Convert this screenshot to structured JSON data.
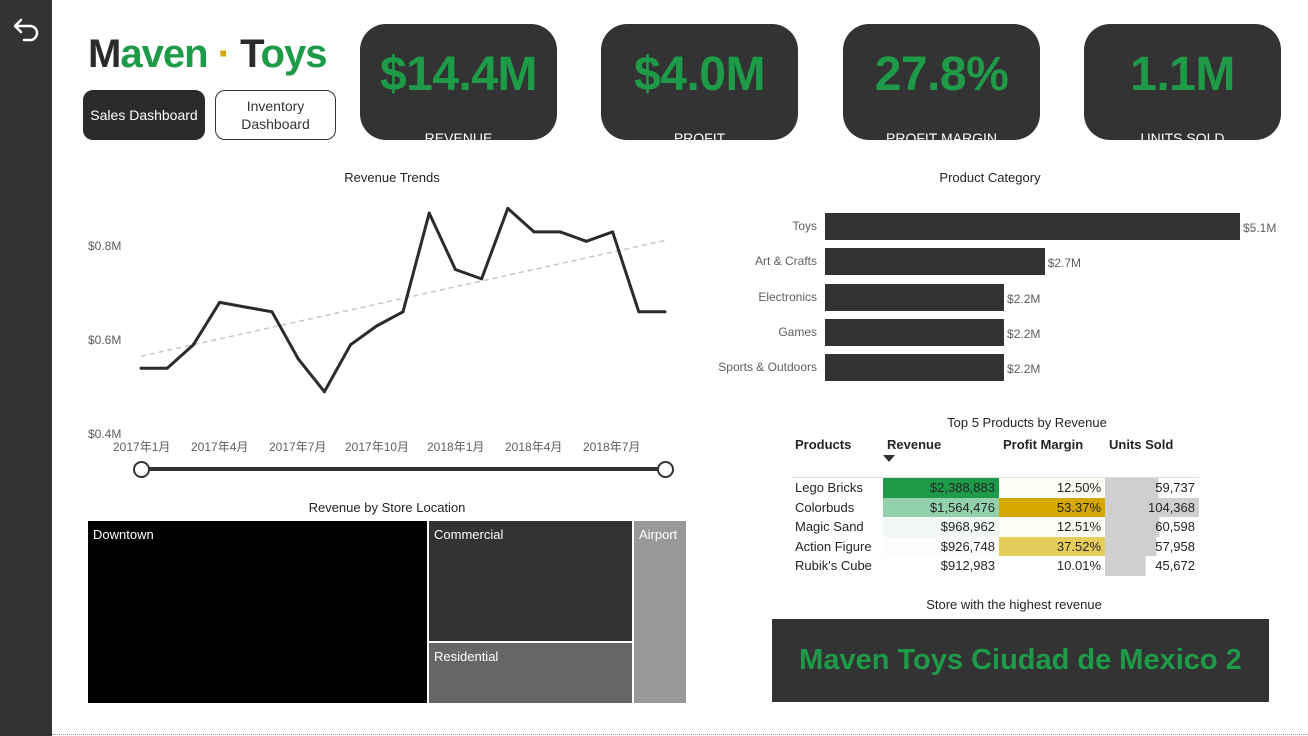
{
  "logo": {
    "part1_dark": "M",
    "part1_green": "aven",
    "dot": "·",
    "part2_dark": "T",
    "part2_green": "oys"
  },
  "nav": {
    "sales": "Sales Dashboard",
    "inventory": "Inventory Dashboard"
  },
  "kpis": [
    {
      "value": "$14.4M",
      "label": "REVENUE"
    },
    {
      "value": "$4.0M",
      "label": "PROFIT"
    },
    {
      "value": "27.8%",
      "label": "PROFIT MARGIN"
    },
    {
      "value": "1.1M",
      "label": "UNITS SOLD"
    }
  ],
  "revenue_trends": {
    "title": "Revenue Trends",
    "y_ticks": [
      "$0.8M",
      "$0.6M",
      "$0.4M"
    ],
    "x_ticks": [
      "2017年1月",
      "2017年4月",
      "2017年7月",
      "2017年10月",
      "2018年1月",
      "2018年4月",
      "2018年7月"
    ]
  },
  "product_category": {
    "title": "Product Category"
  },
  "top_products": {
    "title": "Top 5 Products by Revenue",
    "headers": [
      "Products",
      "Revenue",
      "Profit Margin",
      "Units Sold"
    ],
    "rows": [
      {
        "product": "Lego Bricks",
        "revenue": "$2,388,883",
        "margin": "12.50%",
        "units": "59,737"
      },
      {
        "product": "Colorbuds",
        "revenue": "$1,564,476",
        "margin": "53.37%",
        "units": "104,368"
      },
      {
        "product": "Magic Sand",
        "revenue": "$968,962",
        "margin": "12.51%",
        "units": "60,598"
      },
      {
        "product": "Action Figure",
        "revenue": "$926,748",
        "margin": "37.52%",
        "units": "57,958"
      },
      {
        "product": "Rubik's Cube",
        "revenue": "$912,983",
        "margin": "10.01%",
        "units": "45,672"
      }
    ]
  },
  "store_location": {
    "title": "Revenue by Store Location",
    "tiles": [
      "Downtown",
      "Commercial",
      "Residential",
      "Airport"
    ]
  },
  "highest_store": {
    "title": "Store with the highest revenue",
    "value": "Maven Toys Ciudad de Mexico 2"
  },
  "chart_data": [
    {
      "type": "line",
      "x": [
        "2017-01",
        "2017-02",
        "2017-03",
        "2017-04",
        "2017-05",
        "2017-06",
        "2017-07",
        "2017-08",
        "2017-09",
        "2017-10",
        "2017-11",
        "2017-12",
        "2018-01",
        "2018-02",
        "2018-03",
        "2018-04",
        "2018-05",
        "2018-06",
        "2018-07",
        "2018-08",
        "2018-09",
        "2018-10"
      ],
      "y": [
        0.54,
        0.54,
        0.59,
        0.68,
        0.67,
        0.66,
        0.56,
        0.49,
        0.59,
        0.63,
        0.66,
        0.87,
        0.75,
        0.73,
        0.88,
        0.83,
        0.83,
        0.81,
        0.83,
        0.66,
        0.66
      ],
      "trendline": true,
      "ylim": [
        0.4,
        0.9
      ],
      "xlabel": "",
      "ylabel": ""
    },
    {
      "type": "bar",
      "categories": [
        "Toys",
        "Art & Crafts",
        "Electronics",
        "Games",
        "Sports & Outdoors"
      ],
      "values": [
        5.1,
        2.7,
        2.2,
        2.2,
        2.2
      ],
      "value_labels": [
        "$5.1M",
        "$2.7M",
        "$2.2M",
        "$2.2M",
        "$2.2M"
      ]
    },
    {
      "type": "treemap",
      "categories": [
        "Downtown",
        "Commercial",
        "Residential",
        "Airport"
      ]
    }
  ],
  "colors": {
    "accent_green": "#1e9b48",
    "gold": "#d4a800",
    "dark": "#333333"
  }
}
